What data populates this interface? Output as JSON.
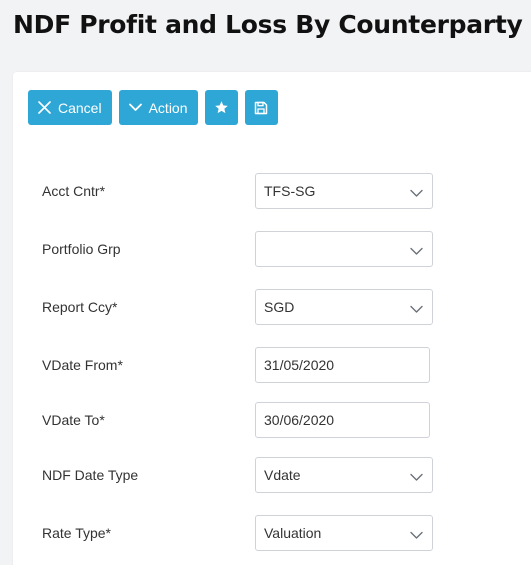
{
  "page": {
    "title": "NDF Profit and Loss By Counterparty"
  },
  "toolbar": {
    "cancel_label": "Cancel",
    "action_label": "Action",
    "favorite_icon": "star-icon",
    "save_icon": "save-icon",
    "accent_color": "#2ea7d6"
  },
  "form": {
    "acct_cntr": {
      "label": "Acct Cntr*",
      "value": "TFS-SG"
    },
    "portfolio_grp": {
      "label": "Portfolio Grp",
      "value": ""
    },
    "report_ccy": {
      "label": "Report Ccy*",
      "value": "SGD"
    },
    "vdate_from": {
      "label": "VDate From*",
      "value": "31/05/2020"
    },
    "vdate_to": {
      "label": "VDate To*",
      "value": "30/06/2020"
    },
    "ndf_date_type": {
      "label": "NDF Date Type",
      "value": "Vdate"
    },
    "rate_type": {
      "label": "Rate Type*",
      "value": "Valuation"
    }
  }
}
